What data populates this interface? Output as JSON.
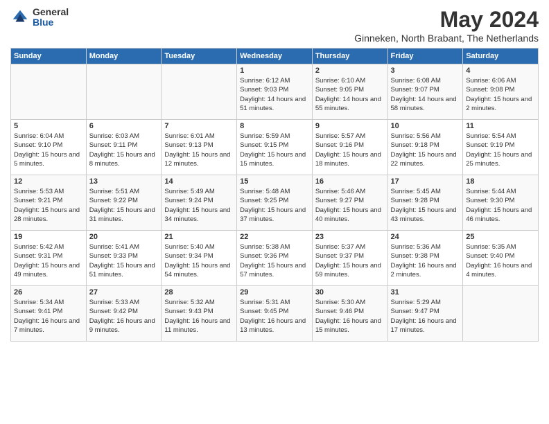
{
  "header": {
    "logo": {
      "general": "General",
      "blue": "Blue"
    },
    "title": "May 2024",
    "location": "Ginneken, North Brabant, The Netherlands"
  },
  "days_of_week": [
    "Sunday",
    "Monday",
    "Tuesday",
    "Wednesday",
    "Thursday",
    "Friday",
    "Saturday"
  ],
  "weeks": [
    [
      {
        "day": "",
        "info": ""
      },
      {
        "day": "",
        "info": ""
      },
      {
        "day": "",
        "info": ""
      },
      {
        "day": "1",
        "info": "Sunrise: 6:12 AM\nSunset: 9:03 PM\nDaylight: 14 hours and 51 minutes."
      },
      {
        "day": "2",
        "info": "Sunrise: 6:10 AM\nSunset: 9:05 PM\nDaylight: 14 hours and 55 minutes."
      },
      {
        "day": "3",
        "info": "Sunrise: 6:08 AM\nSunset: 9:07 PM\nDaylight: 14 hours and 58 minutes."
      },
      {
        "day": "4",
        "info": "Sunrise: 6:06 AM\nSunset: 9:08 PM\nDaylight: 15 hours and 2 minutes."
      }
    ],
    [
      {
        "day": "5",
        "info": "Sunrise: 6:04 AM\nSunset: 9:10 PM\nDaylight: 15 hours and 5 minutes."
      },
      {
        "day": "6",
        "info": "Sunrise: 6:03 AM\nSunset: 9:11 PM\nDaylight: 15 hours and 8 minutes."
      },
      {
        "day": "7",
        "info": "Sunrise: 6:01 AM\nSunset: 9:13 PM\nDaylight: 15 hours and 12 minutes."
      },
      {
        "day": "8",
        "info": "Sunrise: 5:59 AM\nSunset: 9:15 PM\nDaylight: 15 hours and 15 minutes."
      },
      {
        "day": "9",
        "info": "Sunrise: 5:57 AM\nSunset: 9:16 PM\nDaylight: 15 hours and 18 minutes."
      },
      {
        "day": "10",
        "info": "Sunrise: 5:56 AM\nSunset: 9:18 PM\nDaylight: 15 hours and 22 minutes."
      },
      {
        "day": "11",
        "info": "Sunrise: 5:54 AM\nSunset: 9:19 PM\nDaylight: 15 hours and 25 minutes."
      }
    ],
    [
      {
        "day": "12",
        "info": "Sunrise: 5:53 AM\nSunset: 9:21 PM\nDaylight: 15 hours and 28 minutes."
      },
      {
        "day": "13",
        "info": "Sunrise: 5:51 AM\nSunset: 9:22 PM\nDaylight: 15 hours and 31 minutes."
      },
      {
        "day": "14",
        "info": "Sunrise: 5:49 AM\nSunset: 9:24 PM\nDaylight: 15 hours and 34 minutes."
      },
      {
        "day": "15",
        "info": "Sunrise: 5:48 AM\nSunset: 9:25 PM\nDaylight: 15 hours and 37 minutes."
      },
      {
        "day": "16",
        "info": "Sunrise: 5:46 AM\nSunset: 9:27 PM\nDaylight: 15 hours and 40 minutes."
      },
      {
        "day": "17",
        "info": "Sunrise: 5:45 AM\nSunset: 9:28 PM\nDaylight: 15 hours and 43 minutes."
      },
      {
        "day": "18",
        "info": "Sunrise: 5:44 AM\nSunset: 9:30 PM\nDaylight: 15 hours and 46 minutes."
      }
    ],
    [
      {
        "day": "19",
        "info": "Sunrise: 5:42 AM\nSunset: 9:31 PM\nDaylight: 15 hours and 49 minutes."
      },
      {
        "day": "20",
        "info": "Sunrise: 5:41 AM\nSunset: 9:33 PM\nDaylight: 15 hours and 51 minutes."
      },
      {
        "day": "21",
        "info": "Sunrise: 5:40 AM\nSunset: 9:34 PM\nDaylight: 15 hours and 54 minutes."
      },
      {
        "day": "22",
        "info": "Sunrise: 5:38 AM\nSunset: 9:36 PM\nDaylight: 15 hours and 57 minutes."
      },
      {
        "day": "23",
        "info": "Sunrise: 5:37 AM\nSunset: 9:37 PM\nDaylight: 15 hours and 59 minutes."
      },
      {
        "day": "24",
        "info": "Sunrise: 5:36 AM\nSunset: 9:38 PM\nDaylight: 16 hours and 2 minutes."
      },
      {
        "day": "25",
        "info": "Sunrise: 5:35 AM\nSunset: 9:40 PM\nDaylight: 16 hours and 4 minutes."
      }
    ],
    [
      {
        "day": "26",
        "info": "Sunrise: 5:34 AM\nSunset: 9:41 PM\nDaylight: 16 hours and 7 minutes."
      },
      {
        "day": "27",
        "info": "Sunrise: 5:33 AM\nSunset: 9:42 PM\nDaylight: 16 hours and 9 minutes."
      },
      {
        "day": "28",
        "info": "Sunrise: 5:32 AM\nSunset: 9:43 PM\nDaylight: 16 hours and 11 minutes."
      },
      {
        "day": "29",
        "info": "Sunrise: 5:31 AM\nSunset: 9:45 PM\nDaylight: 16 hours and 13 minutes."
      },
      {
        "day": "30",
        "info": "Sunrise: 5:30 AM\nSunset: 9:46 PM\nDaylight: 16 hours and 15 minutes."
      },
      {
        "day": "31",
        "info": "Sunrise: 5:29 AM\nSunset: 9:47 PM\nDaylight: 16 hours and 17 minutes."
      },
      {
        "day": "",
        "info": ""
      }
    ]
  ]
}
